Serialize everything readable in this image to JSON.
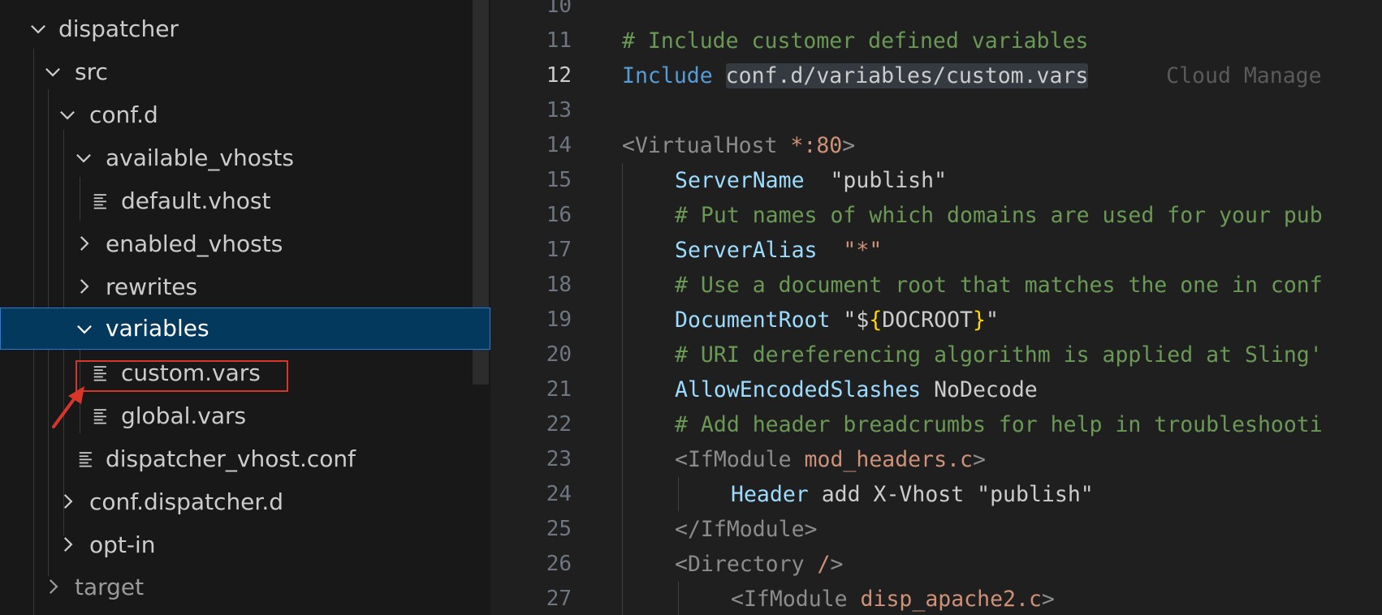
{
  "explorer": {
    "items": [
      {
        "label": "dispatcher",
        "type": "folder",
        "expanded": true,
        "depth": 0,
        "icon": "chevron-down-icon"
      },
      {
        "label": "src",
        "type": "folder",
        "expanded": true,
        "depth": 1,
        "icon": "chevron-down-icon"
      },
      {
        "label": "conf.d",
        "type": "folder",
        "expanded": true,
        "depth": 2,
        "icon": "chevron-down-icon"
      },
      {
        "label": "available_vhosts",
        "type": "folder",
        "expanded": true,
        "depth": 3,
        "icon": "chevron-down-icon"
      },
      {
        "label": "default.vhost",
        "type": "file",
        "depth": 4,
        "icon": "file-lines-icon"
      },
      {
        "label": "enabled_vhosts",
        "type": "folder",
        "expanded": false,
        "depth": 3,
        "icon": "chevron-right-icon"
      },
      {
        "label": "rewrites",
        "type": "folder",
        "expanded": false,
        "depth": 3,
        "icon": "chevron-right-icon"
      },
      {
        "label": "variables",
        "type": "folder",
        "expanded": true,
        "depth": 3,
        "selected": true,
        "icon": "chevron-down-icon"
      },
      {
        "label": "custom.vars",
        "type": "file",
        "depth": 4,
        "annotated": true,
        "icon": "file-lines-icon"
      },
      {
        "label": "global.vars",
        "type": "file",
        "depth": 4,
        "icon": "file-lines-icon"
      },
      {
        "label": "dispatcher_vhost.conf",
        "type": "file",
        "depth": 3,
        "icon": "file-lines-icon"
      },
      {
        "label": "conf.dispatcher.d",
        "type": "folder",
        "expanded": false,
        "depth": 2,
        "icon": "chevron-right-icon"
      },
      {
        "label": "opt-in",
        "type": "folder",
        "expanded": false,
        "depth": 2,
        "icon": "chevron-right-icon"
      },
      {
        "label": "target",
        "type": "folder",
        "expanded": false,
        "depth": 1,
        "icon": "chevron-right-icon"
      }
    ],
    "annotation": {
      "color": "#d9362b",
      "icon": "red-arrow-icon"
    }
  },
  "editor": {
    "active_line": "12",
    "lines": [
      {
        "num": "10",
        "text": ""
      },
      {
        "num": "11",
        "text": "# Include customer defined variables"
      },
      {
        "num": "12",
        "kw": "Include",
        "path": "conf.d/variables/custom.vars",
        "ghost": "Cloud Manage"
      },
      {
        "num": "13",
        "text": ""
      },
      {
        "num": "14",
        "open": "<VirtualHost ",
        "star": "*",
        "port": ":80",
        "close": ">"
      },
      {
        "num": "15",
        "attr": "ServerName",
        "value": "  \"publish\""
      },
      {
        "num": "16",
        "text": "# Put names of which domains are used for your pub"
      },
      {
        "num": "17",
        "attr": "ServerAlias",
        "value": "  \"*\""
      },
      {
        "num": "18",
        "text": "# Use a document root that matches the one in conf"
      },
      {
        "num": "19",
        "attr": "DocumentRoot",
        "pre": " \"$",
        "brace_open": "{",
        "var": "DOCROOT",
        "brace_close": "}",
        "post": "\""
      },
      {
        "num": "20",
        "text": "# URI dereferencing algorithm is applied at Sling'"
      },
      {
        "num": "21",
        "attr": "AllowEncodedSlashes",
        "value": " NoDecode"
      },
      {
        "num": "22",
        "text": "# Add header breadcrumbs for help in troubleshooti"
      },
      {
        "num": "23",
        "open": "<IfModule ",
        "module": "mod_headers.c",
        "close": ">"
      },
      {
        "num": "24",
        "attr": "Header",
        "value": " add X-Vhost \"publish\""
      },
      {
        "num": "25",
        "text": "</IfModule>"
      },
      {
        "num": "26",
        "open": "<Directory ",
        "module": "/",
        "close": ">"
      },
      {
        "num": "27",
        "open": "<IfModule ",
        "module": "disp_apache2.c",
        "close": ">"
      }
    ]
  }
}
